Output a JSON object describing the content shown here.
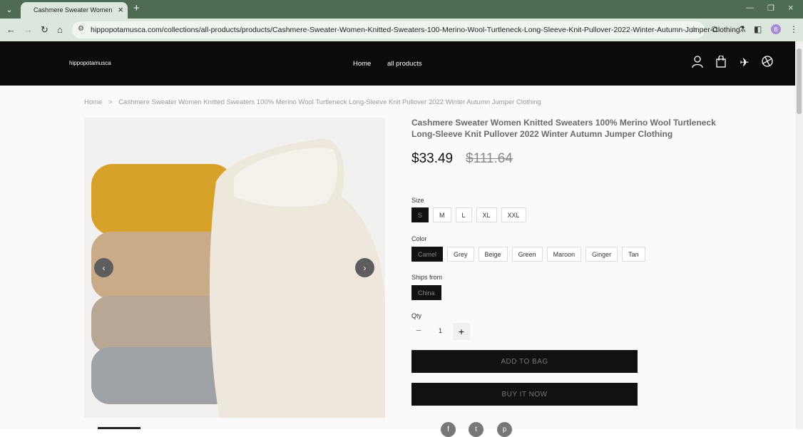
{
  "browser": {
    "tab_title": "Cashmere Sweater Women Knit",
    "url": "hippopotamusca.com/collections/all-products/products/Cashmere-Sweater-Women-Knitted-Sweaters-100-Merino-Wool-Turtleneck-Long-Sleeve-Knit-Pullover-2022-Winter-Autumn-Jumper-Clothing",
    "profile_initial": "B"
  },
  "header": {
    "logo": "hippopotamusca",
    "nav": [
      "Home",
      "all products"
    ]
  },
  "breadcrumb": {
    "home": "Home",
    "separator": ">",
    "current": "Cashmere Sweater Women Knitted Sweaters 100% Merino Wool Turtleneck Long-Sleeve Knit Pullover 2022 Winter Autumn Jumper Clothing"
  },
  "product": {
    "title": "Cashmere Sweater Women Knitted Sweaters 100% Merino Wool Turtleneck Long-Sleeve Knit Pullover 2022 Winter Autumn Jumper Clothing",
    "price": "$33.49",
    "compare_price": "$111.64",
    "size_label": "Size",
    "sizes": [
      "S",
      "M",
      "L",
      "XL",
      "XXL"
    ],
    "color_label": "Color",
    "colors": [
      "Camel",
      "Grey",
      "Beige",
      "Green",
      "Maroon",
      "Ginger",
      "Tan"
    ],
    "ships_label": "Ships from",
    "ships": [
      "China"
    ],
    "qty_label": "Qty",
    "qty": "1",
    "add_to_bag": "ADD TO BAG",
    "buy_now": "BUY IT NOW"
  },
  "icons": {
    "account": "user-icon",
    "bag": "shopping-bag-icon",
    "plane": "airplane-icon",
    "globe": "globe-icon",
    "social": [
      "facebook-icon",
      "twitter-icon",
      "pinterest-icon"
    ]
  },
  "colors": {
    "header_bg": "#0b0b0b",
    "chrome_tabstrip": "#4e6b55",
    "chrome_toolbar": "#dbe7dc",
    "button_bg": "#111111"
  }
}
